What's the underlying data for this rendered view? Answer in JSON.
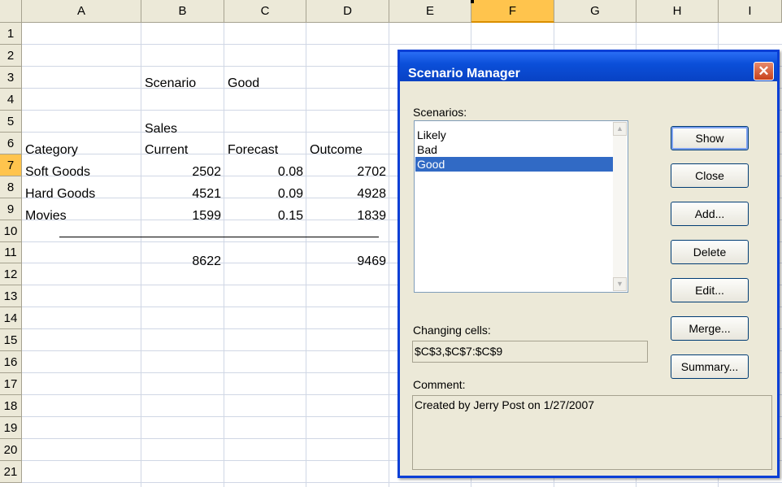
{
  "sheet": {
    "columns": [
      "A",
      "B",
      "C",
      "D",
      "E",
      "F",
      "G",
      "H",
      "I"
    ],
    "rows": [
      "1",
      "2",
      "3",
      "4",
      "5",
      "6",
      "7",
      "8",
      "9",
      "10",
      "11",
      "12",
      "13",
      "14",
      "15",
      "16",
      "17",
      "18",
      "19",
      "20",
      "21"
    ],
    "cells": {
      "B3": "Scenario",
      "C3": "Good",
      "B5": "Sales",
      "A6": "Category",
      "B6": "Current",
      "C6": "Forecast",
      "D6": "Outcome",
      "A7": "Soft Goods",
      "B7": "2502",
      "C7": "0.08",
      "D7": "2702",
      "A8": "Hard Goods",
      "B8": "4521",
      "C8": "0.09",
      "D8": "4928",
      "A9": "Movies",
      "B9": "1599",
      "C9": "0.15",
      "D9": "1839",
      "B11": "8622",
      "D11": "9469"
    }
  },
  "dialog": {
    "title": "Scenario Manager",
    "close_glyph": "✕",
    "scenarios_label": "Scenarios:",
    "scenarios": [
      "Likely",
      "Bad",
      "Good"
    ],
    "selected_scenario": "Good",
    "changing_cells_label": "Changing cells:",
    "changing_cells": "$C$3,$C$7:$C$9",
    "comment_label": "Comment:",
    "comment": "Created by Jerry Post on 1/27/2007",
    "buttons": {
      "show": "Show",
      "close": "Close",
      "add": "Add...",
      "delete": "Delete",
      "edit": "Edit...",
      "merge": "Merge...",
      "summary": "Summary..."
    }
  }
}
